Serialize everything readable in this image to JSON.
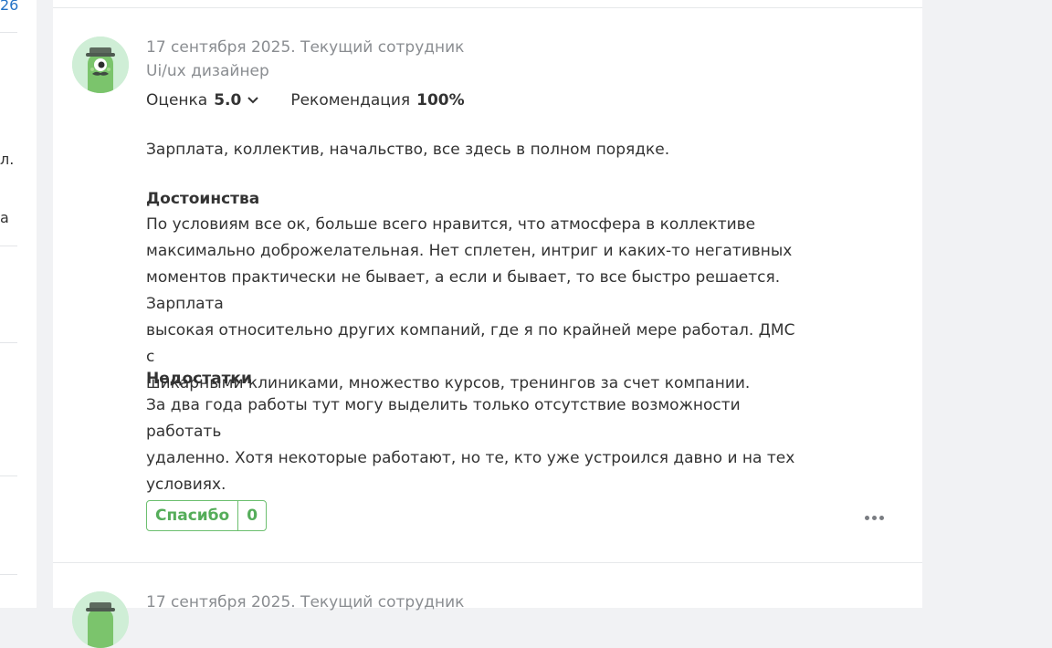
{
  "left_column": {
    "fragments": [
      "26",
      "л.",
      "а"
    ]
  },
  "reviews": [
    {
      "date_status": "17 сентября 2025. Текущий сотрудник",
      "position": "Ui/ux дизайнер",
      "rating_label": "Оценка",
      "rating_value": "5.0",
      "recommend_label": "Рекомендация",
      "recommend_value": "100%",
      "summary": "Зарплата, коллектив, начальство, все здесь в полном порядке.",
      "pros_heading": "Достоинства",
      "pros_lines": [
        "По условиям все ок, больше всего нравится, что атмосфера в коллективе",
        "максимально доброжелательная. Нет сплетен, интриг и каких-то негативных",
        "моментов практически не бывает, а если и бывает, то все быстро решается. Зарплата",
        "высокая относительно других компаний, где я по крайней мере работал. ДМС с",
        "шикарными клиниками, множество курсов, тренингов за счет компании."
      ],
      "cons_heading": "Недостатки",
      "cons_lines": [
        "За два года работы тут могу выделить только отсутствие возможности работать",
        "удаленно. Хотя некоторые работают, но те, кто уже устроился давно и на тех",
        "условиях."
      ],
      "thanks_label": "Спасибо",
      "thanks_count": "0"
    },
    {
      "date_status": "17 сентября 2025. Текущий сотрудник"
    }
  ],
  "colors": {
    "accent_green": "#55ad5a",
    "link_blue": "#2372c6",
    "muted_text": "#8a8d91"
  },
  "icons": [
    "avatar-mascot-icon",
    "chevron-down-icon",
    "more-options-icon"
  ]
}
